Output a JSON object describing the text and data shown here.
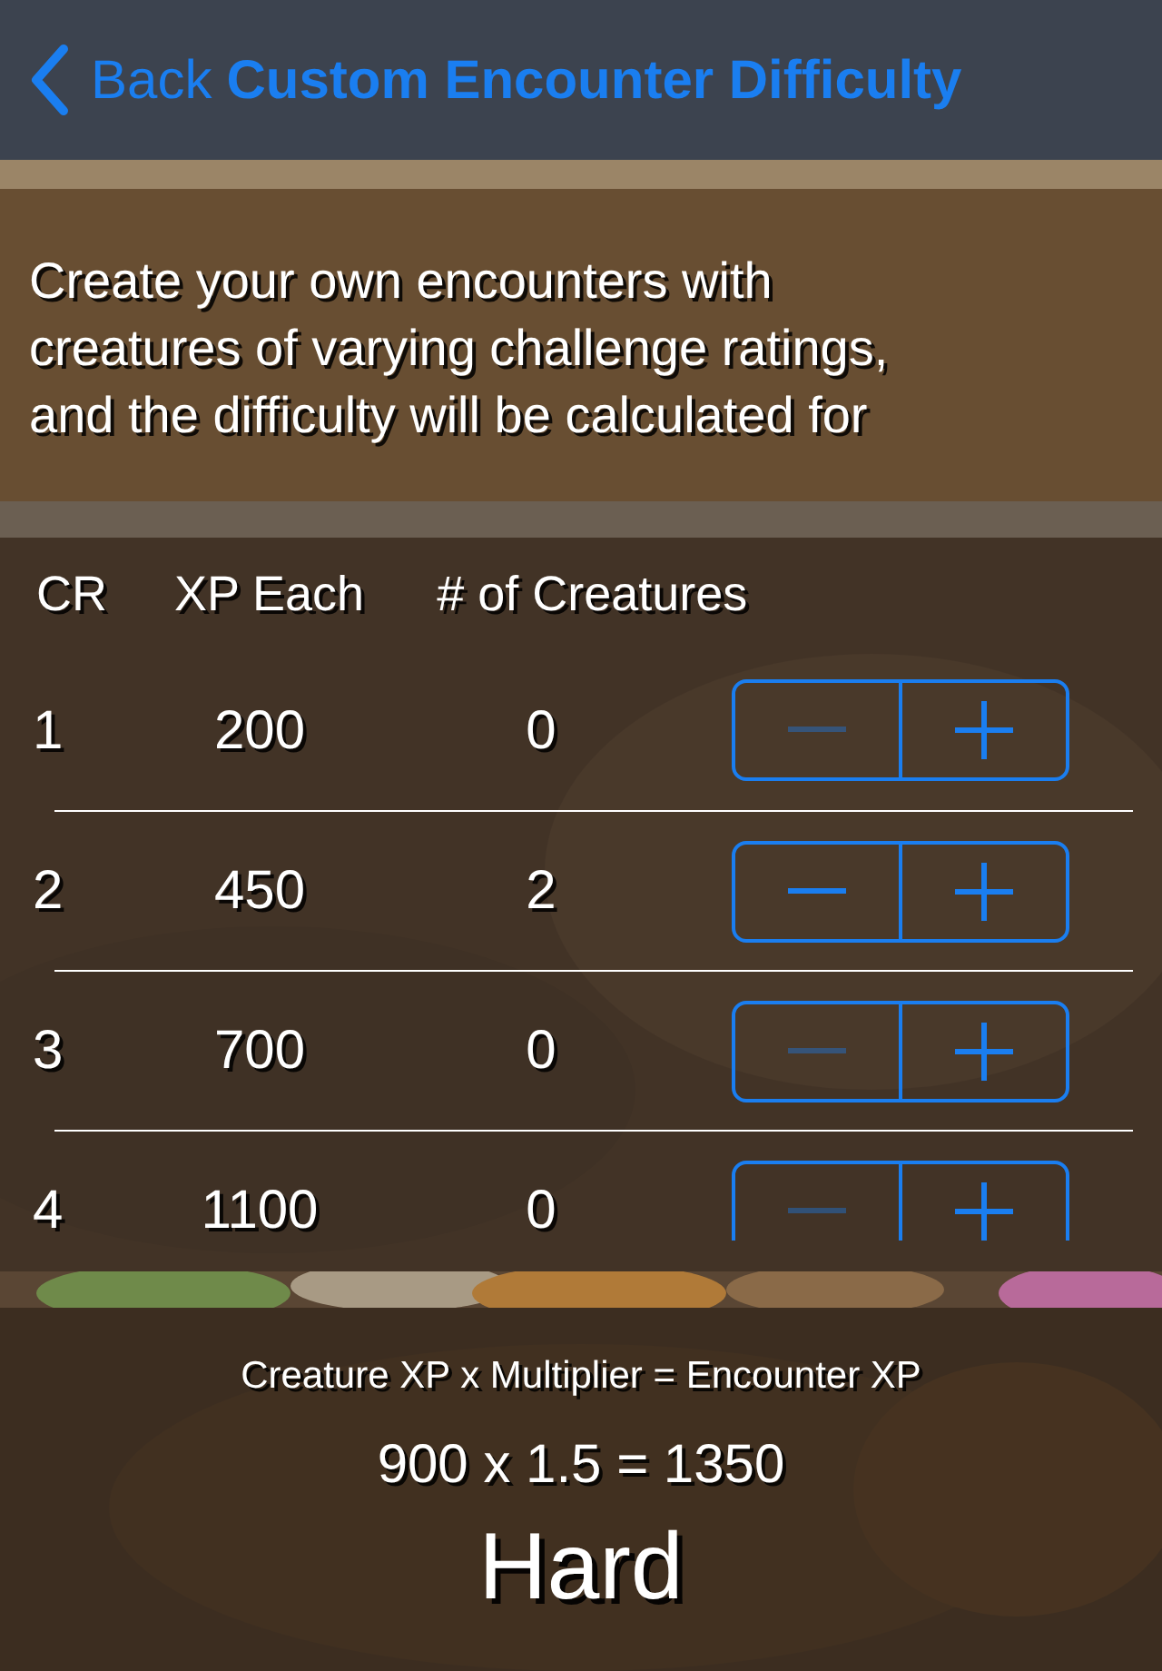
{
  "nav": {
    "back": "Back",
    "title": "Custom Encounter Difficulty"
  },
  "description_lines": [
    "Create your own encounters with",
    "creatures of varying challenge ratings,",
    "and the difficulty will be calculated for"
  ],
  "table": {
    "columns": [
      "CR",
      "XP Each",
      "# of Creatures"
    ],
    "rows": [
      {
        "cr": "1",
        "xp": "200",
        "count": "0",
        "minus_disabled": true
      },
      {
        "cr": "2",
        "xp": "450",
        "count": "2",
        "minus_disabled": false
      },
      {
        "cr": "3",
        "xp": "700",
        "count": "0",
        "minus_disabled": true
      },
      {
        "cr": "4",
        "xp": "1100",
        "count": "0",
        "minus_disabled": true
      }
    ]
  },
  "result": {
    "formula": "Creature XP x Multiplier = Encounter XP",
    "equation": "900 x 1.5 = 1350",
    "difficulty": "Hard"
  }
}
